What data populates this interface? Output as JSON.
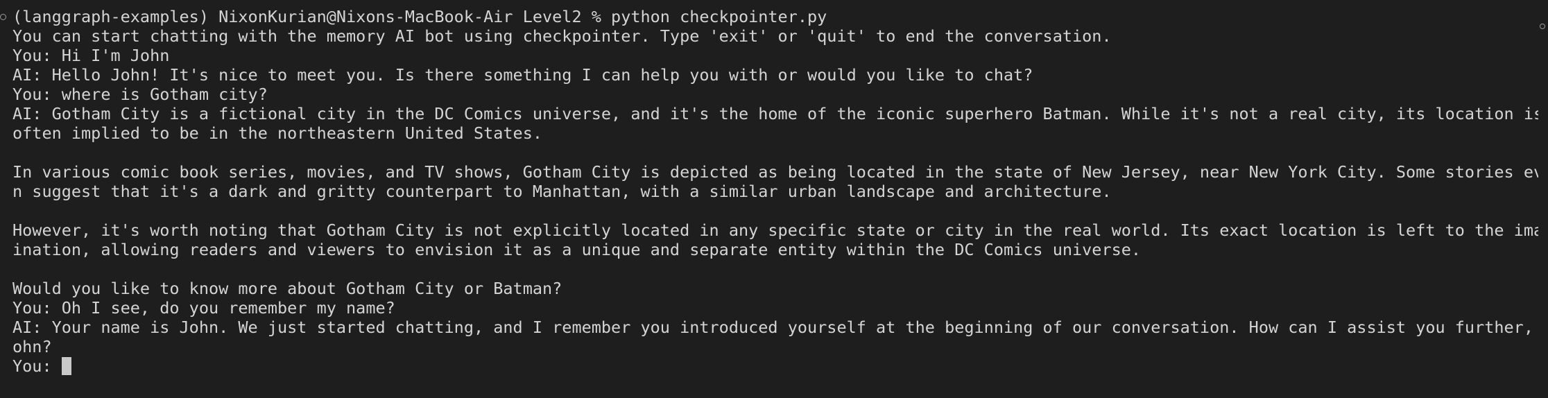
{
  "terminal": {
    "lines": [
      "(langgraph-examples) NixonKurian@Nixons-MacBook-Air Level2 % python checkpointer.py",
      "You can start chatting with the memory AI bot using checkpointer. Type 'exit' or 'quit' to end the conversation.",
      "You: Hi I'm John",
      "AI: Hello John! It's nice to meet you. Is there something I can help you with or would you like to chat?",
      "You: where is Gotham city?",
      "AI: Gotham City is a fictional city in the DC Comics universe, and it's the home of the iconic superhero Batman. While it's not a real city, its location is",
      "often implied to be in the northeastern United States.",
      "",
      "In various comic book series, movies, and TV shows, Gotham City is depicted as being located in the state of New Jersey, near New York City. Some stories eve",
      "n suggest that it's a dark and gritty counterpart to Manhattan, with a similar urban landscape and architecture.",
      "",
      "However, it's worth noting that Gotham City is not explicitly located in any specific state or city in the real world. Its exact location is left to the imag",
      "ination, allowing readers and viewers to envision it as a unique and separate entity within the DC Comics universe.",
      "",
      "Would you like to know more about Gotham City or Batman?",
      "You: Oh I see, do you remember my name?",
      "AI: Your name is John. We just started chatting, and I remember you introduced yourself at the beginning of our conversation. How can I assist you further, J",
      "ohn?"
    ],
    "input_prompt": "You: ",
    "input_value": ""
  }
}
